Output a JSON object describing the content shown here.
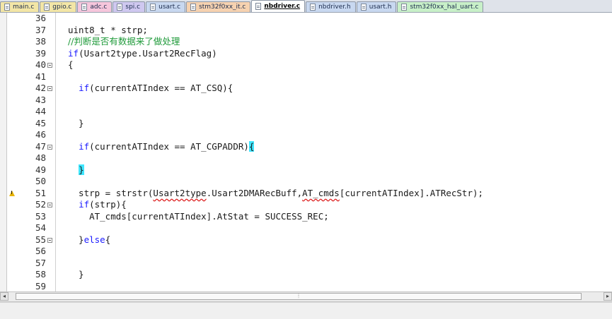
{
  "tabs": [
    {
      "label": "main.c",
      "color": "#f3e6a6",
      "active": false
    },
    {
      "label": "gpio.c",
      "color": "#f3e6a6",
      "active": false
    },
    {
      "label": "adc.c",
      "color": "#f6c6dc",
      "active": false
    },
    {
      "label": "spi.c",
      "color": "#cfc8f0",
      "active": false
    },
    {
      "label": "usart.c",
      "color": "#c8d8f0",
      "active": false
    },
    {
      "label": "stm32f0xx_it.c",
      "color": "#f6d2b0",
      "active": false
    },
    {
      "label": "nbdriver.c",
      "color": "#ffffff",
      "active": true
    },
    {
      "label": "nbdriver.h",
      "color": "#c8d8f0",
      "active": false
    },
    {
      "label": "usart.h",
      "color": "#c8d8f0",
      "active": false
    },
    {
      "label": "stm32f0xx_hal_uart.c",
      "color": "#c8f0c8",
      "active": false
    }
  ],
  "editor": {
    "lines": [
      {
        "num": "36",
        "segments": []
      },
      {
        "num": "37",
        "segments": [
          {
            "t": "uint8_t * strp;",
            "c": ""
          }
        ]
      },
      {
        "num": "38",
        "segments": [
          {
            "t": "//判断是否有数据来了做处理",
            "c": "comment"
          }
        ]
      },
      {
        "num": "39",
        "segments": [
          {
            "t": "if",
            "c": "kw"
          },
          {
            "t": "(Usart2type.Usart2RecFlag)",
            "c": ""
          }
        ]
      },
      {
        "num": "40",
        "fold": true,
        "segments": [
          {
            "t": "{",
            "c": ""
          }
        ]
      },
      {
        "num": "41",
        "segments": []
      },
      {
        "num": "42",
        "fold": true,
        "segments": [
          {
            "t": "  ",
            "c": ""
          },
          {
            "t": "if",
            "c": "kw"
          },
          {
            "t": "(currentATIndex == AT_CSQ){",
            "c": ""
          }
        ]
      },
      {
        "num": "43",
        "segments": []
      },
      {
        "num": "44",
        "segments": []
      },
      {
        "num": "45",
        "segments": [
          {
            "t": "  }",
            "c": ""
          }
        ]
      },
      {
        "num": "46",
        "segments": []
      },
      {
        "num": "47",
        "fold": true,
        "segments": [
          {
            "t": "  ",
            "c": ""
          },
          {
            "t": "if",
            "c": "kw"
          },
          {
            "t": "(currentATIndex == AT_CGPADDR)",
            "c": ""
          },
          {
            "t": "{",
            "c": "hl"
          }
        ]
      },
      {
        "num": "48",
        "segments": []
      },
      {
        "num": "49",
        "segments": [
          {
            "t": "  ",
            "c": ""
          },
          {
            "t": "}",
            "c": "hl"
          }
        ]
      },
      {
        "num": "50",
        "segments": []
      },
      {
        "num": "51",
        "warn": true,
        "segments": [
          {
            "t": "  strp = strstr(",
            "c": ""
          },
          {
            "t": "Usart2type",
            "c": "sq"
          },
          {
            "t": ".Usart2DMARecBuff,",
            "c": ""
          },
          {
            "t": "AT_cmds",
            "c": "sq"
          },
          {
            "t": "[currentATIndex].ATRecStr);",
            "c": ""
          }
        ]
      },
      {
        "num": "52",
        "fold": true,
        "segments": [
          {
            "t": "  ",
            "c": ""
          },
          {
            "t": "if",
            "c": "kw"
          },
          {
            "t": "(strp){",
            "c": ""
          }
        ]
      },
      {
        "num": "53",
        "segments": [
          {
            "t": "    AT_cmds[currentATIndex].AtStat = SUCCESS_REC;",
            "c": ""
          }
        ]
      },
      {
        "num": "54",
        "segments": []
      },
      {
        "num": "55",
        "fold": true,
        "segments": [
          {
            "t": "  }",
            "c": ""
          },
          {
            "t": "else",
            "c": "kw"
          },
          {
            "t": "{",
            "c": ""
          }
        ]
      },
      {
        "num": "56",
        "segments": []
      },
      {
        "num": "57",
        "segments": []
      },
      {
        "num": "58",
        "segments": [
          {
            "t": "  }",
            "c": ""
          }
        ]
      },
      {
        "num": "59",
        "segments": []
      }
    ]
  },
  "scrollbar": {
    "left_arrow": "◂",
    "right_arrow": "▸",
    "thumb_grip": "⦙"
  }
}
